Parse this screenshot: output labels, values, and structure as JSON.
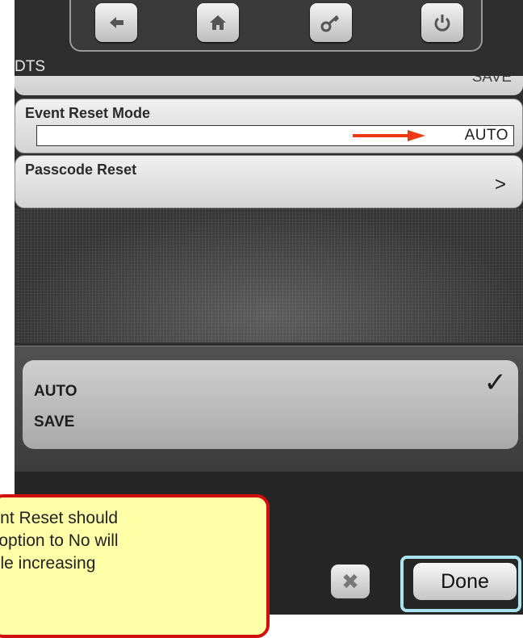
{
  "app": {
    "title": "DTS"
  },
  "nav": {
    "icons": [
      "back-arrow-icon",
      "home-icon",
      "key-icon",
      "power-icon"
    ]
  },
  "settings": {
    "partial_value": "SAVE",
    "event_reset": {
      "label": "Event Reset Mode",
      "value": "AUTO"
    },
    "passcode_reset": {
      "label": "Passcode Reset",
      "chevron": ">"
    }
  },
  "picker": {
    "options": [
      "AUTO",
      "SAVE"
    ],
    "selected": "AUTO",
    "check": "✓"
  },
  "buttons": {
    "cancel": "✖",
    "done": "Done"
  },
  "callout": {
    "lines": [
      "vent Reset should",
      "s option to No will",
      "file increasing"
    ]
  },
  "colors": {
    "callout_border": "#d20f0f",
    "callout_bg": "#ffffa8",
    "arrow": "#ee3a12",
    "done_highlight": "#a9e4ef"
  }
}
